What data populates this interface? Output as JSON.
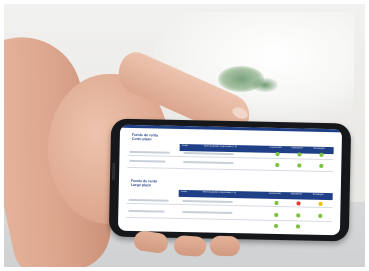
{
  "scene": {
    "description_colors": {
      "accent": "#1f3f86",
      "green": "#7cc142",
      "red": "#e23b2e",
      "yellow": "#f2c200"
    }
  },
  "phone_screen": {
    "section1": {
      "title_line1": "Fondo de renta",
      "title_line2": "Corto plazo",
      "headers": [
        "Fondo",
        "Nivel de gestión responsable (1-5)",
        "Objetivo",
        "Control ESG",
        "Indicadores",
        "Estrategias"
      ]
    },
    "section2": {
      "title_line1": "Fondo de renta",
      "title_line2": "Largo plazo",
      "headers": [
        "Fondo",
        "Nivel de gestión responsable (1-5)",
        "Objetivo",
        "Control ESG",
        "Indicadores",
        "Estrategias"
      ]
    }
  }
}
